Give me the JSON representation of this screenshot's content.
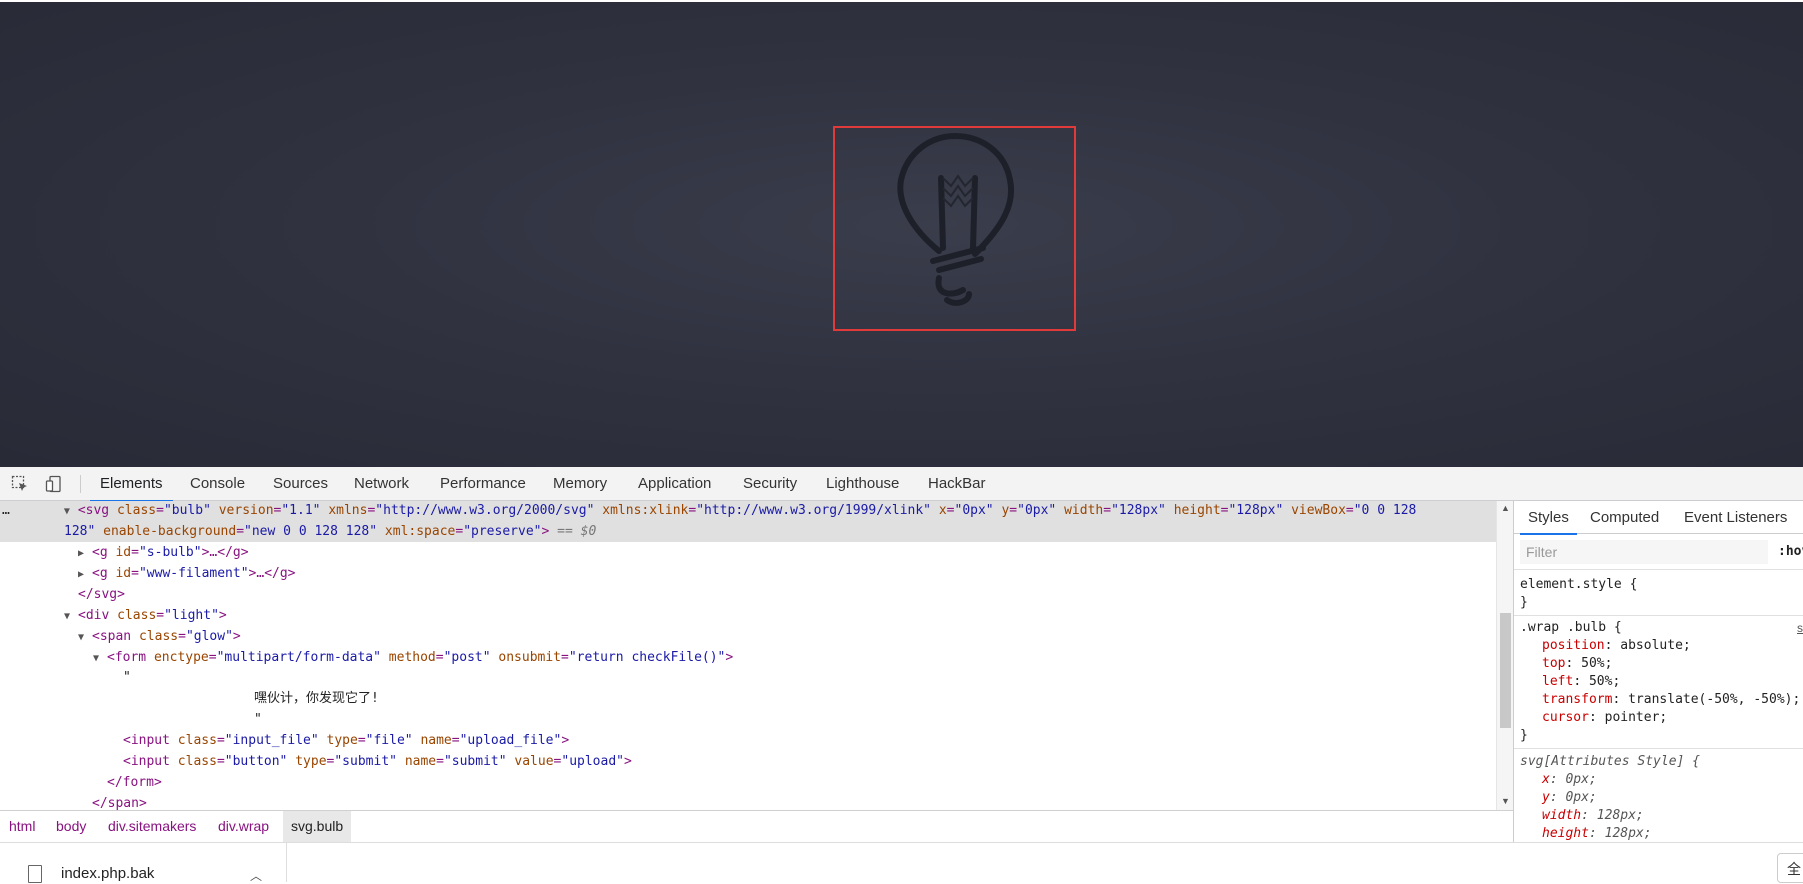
{
  "devtools": {
    "tabs": [
      "Elements",
      "Console",
      "Sources",
      "Network",
      "Performance",
      "Memory",
      "Application",
      "Security",
      "Lighthouse",
      "HackBar"
    ],
    "active_tab": "Elements",
    "elements": {
      "svg_line_1": {
        "tag_open": "<svg",
        "attrs": [
          {
            "name": "class",
            "value": "\"bulb\""
          },
          {
            "name": "version",
            "value": "\"1.1\""
          },
          {
            "name": "xmlns",
            "value": "\"http://www.w3.org/2000/svg\""
          },
          {
            "name": "xmlns:xlink",
            "value": "\"http://www.w3.org/1999/xlink\""
          },
          {
            "name": "x",
            "value": "\"0px\""
          },
          {
            "name": "y",
            "value": "\"0px\""
          },
          {
            "name": "width",
            "value": "\"128px\""
          },
          {
            "name": "height",
            "value": "\"128px\""
          },
          {
            "name": "viewBox",
            "value": "\"0 0 128"
          }
        ]
      },
      "svg_line_2": {
        "cont": "128\"",
        "attr1_name": "enable-background",
        "attr1_value": "\"new 0 0 128 128\"",
        "attr2_name": "xml:space",
        "attr2_value": "\"preserve\"",
        "close": ">",
        "eq": "== $0"
      },
      "g1": {
        "open": "<g",
        "attr_name": "id",
        "attr_value": "\"s-bulb\"",
        "rest": ">…</g>"
      },
      "g2": {
        "open": "<g",
        "attr_name": "id",
        "attr_value": "\"www-filament\"",
        "rest": ">…</g>"
      },
      "svg_close": "</svg>",
      "div_light": {
        "open": "<div",
        "attr_name": "class",
        "attr_value": "\"light\"",
        "close": ">"
      },
      "span_glow": {
        "open": "<span",
        "attr_name": "class",
        "attr_value": "\"glow\"",
        "close": ">"
      },
      "form": {
        "open": "<form",
        "a1n": "enctype",
        "a1v": "\"multipart/form-data\"",
        "a2n": "method",
        "a2v": "\"post\"",
        "a3n": "onsubmit",
        "a3v": "\"return checkFile()\"",
        "close": ">"
      },
      "text_quote_1": "\"",
      "text_cn": "嘿伙计，你发现它了!",
      "text_quote_2": "\"",
      "input1": {
        "open": "<input",
        "a1n": "class",
        "a1v": "\"input_file\"",
        "a2n": "type",
        "a2v": "\"file\"",
        "a3n": "name",
        "a3v": "\"upload_file\"",
        "close": ">"
      },
      "input2": {
        "open": "<input",
        "a1n": "class",
        "a1v": "\"button\"",
        "a2n": "type",
        "a2v": "\"submit\"",
        "a3n": "name",
        "a3v": "\"submit\"",
        "a4n": "value",
        "a4v": "\"upload\"",
        "close": ">"
      },
      "form_close": "</form>",
      "span_close": "</span>"
    },
    "breadcrumb": [
      "html",
      "body",
      "div.sitemakers",
      "div.wrap",
      "svg.bulb"
    ],
    "styles": {
      "tabs": [
        "Styles",
        "Computed",
        "Event Listeners"
      ],
      "filter_placeholder": "Filter",
      "hov": ":hov",
      "element_style_open": "element.style {",
      "element_style_close": "}",
      "rule1_selector": ".wrap .bulb {",
      "rule1_source": "s",
      "rule1_props": [
        {
          "prop": "position",
          "value": "absolute;"
        },
        {
          "prop": "top",
          "value": "50%;"
        },
        {
          "prop": "left",
          "value": "50%;"
        },
        {
          "prop": "transform",
          "value": "translate(-50%, -50%);"
        },
        {
          "prop": "cursor",
          "value": "pointer;"
        }
      ],
      "rule1_close": "}",
      "rule2_selector": "svg[Attributes Style] {",
      "rule2_props": [
        {
          "prop": "x",
          "value": "0px;"
        },
        {
          "prop": "y",
          "value": "0px;"
        },
        {
          "prop": "width",
          "value": "128px;"
        },
        {
          "prop": "height",
          "value": "128px;"
        }
      ]
    }
  },
  "downloads": {
    "file_name": "index.php.bak",
    "right_label": "全"
  },
  "colors": {
    "highlight_box": "#e03a3a",
    "bulb_stroke": "#1e2029",
    "tab_underline": "#1a73e8"
  }
}
